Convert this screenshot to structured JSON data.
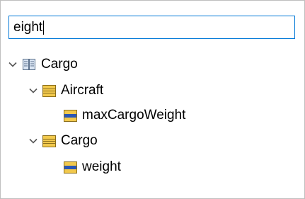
{
  "search": {
    "value": "eight"
  },
  "tree": {
    "root": {
      "label": "Cargo",
      "icon": "data-model-book-icon"
    },
    "groups": [
      {
        "label": "Aircraft",
        "icon": "entity-table-icon",
        "children": [
          {
            "label": "maxCargoWeight",
            "icon": "attribute-field-icon"
          }
        ]
      },
      {
        "label": "Cargo",
        "icon": "entity-table-icon",
        "children": [
          {
            "label": "weight",
            "icon": "attribute-field-icon"
          }
        ]
      }
    ]
  },
  "colors": {
    "focus_border": "#0078d7",
    "entity_icon": "#f2c94c",
    "attribute_icon_band": "#2a56b5"
  }
}
